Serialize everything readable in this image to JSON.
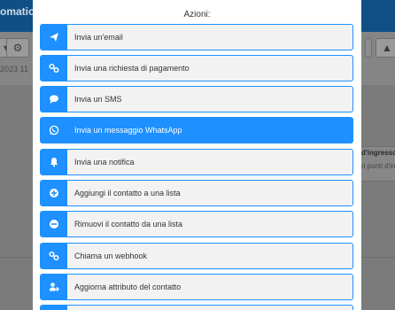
{
  "background": {
    "title_fragment": "omation",
    "date_fragment": "2023 11",
    "right_card_title": "d'ingresso",
    "right_card_text": "ri punti d'in",
    "toolbar_icons": [
      "gear-icon",
      "dropdown-icon",
      "upload-icon",
      "warning-icon"
    ]
  },
  "modal": {
    "title": "Azioni:",
    "accent_color": "#1e90ff",
    "actions": [
      {
        "label": "Invia un'email",
        "icon": "send-icon",
        "active": false
      },
      {
        "label": "Invia una richiesta di pagamento",
        "icon": "link-icon",
        "active": false
      },
      {
        "label": "Invia un SMS",
        "icon": "chat-bubble-icon",
        "active": false
      },
      {
        "label": "Invia un messaggio WhatsApp",
        "icon": "whatsapp-icon",
        "active": true
      },
      {
        "label": "Invia una notifica",
        "icon": "bell-icon",
        "active": false
      },
      {
        "label": "Aggiungi il contatto a una lista",
        "icon": "plus-circle-icon",
        "active": false
      },
      {
        "label": "Rimuovi il contatto da una lista",
        "icon": "minus-circle-icon",
        "active": false
      },
      {
        "label": "Chiama un webhook",
        "icon": "link-icon",
        "active": false
      },
      {
        "label": "Aggiorna attributo del contatto",
        "icon": "user-edit-icon",
        "active": false
      }
    ]
  }
}
